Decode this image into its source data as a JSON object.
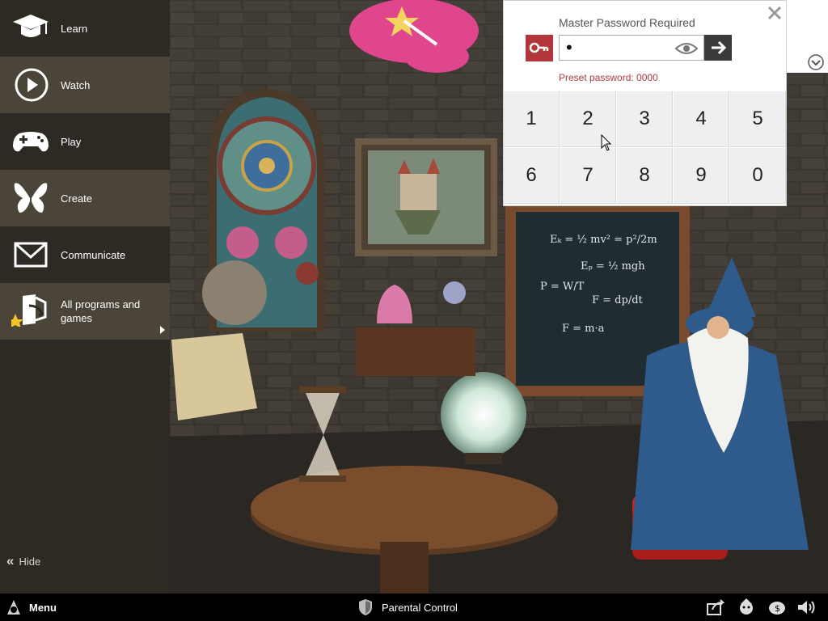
{
  "sidebar": {
    "items": [
      {
        "label": "Learn",
        "icon": "graduation-cap-icon"
      },
      {
        "label": "Watch",
        "icon": "play-circle-icon"
      },
      {
        "label": "Play",
        "icon": "gamepad-icon"
      },
      {
        "label": "Create",
        "icon": "butterfly-icon"
      },
      {
        "label": "Communicate",
        "icon": "envelope-icon"
      },
      {
        "label": "All programs and games",
        "icon": "programs-star-icon"
      }
    ],
    "hide_label": "Hide"
  },
  "taskbar": {
    "menu_label": "Menu",
    "parental_label": "Parental Control"
  },
  "dialog": {
    "title": "Master Password Required",
    "password_value": "•",
    "preset_text": "Preset password: 0000",
    "keys": [
      "1",
      "2",
      "3",
      "4",
      "5",
      "6",
      "7",
      "8",
      "9",
      "0"
    ]
  },
  "colors": {
    "sidebar_bg": "#2d2a23",
    "sidebar_active": "#4a4538",
    "accent_red": "#b2363a",
    "taskbar_bg": "#000000"
  }
}
